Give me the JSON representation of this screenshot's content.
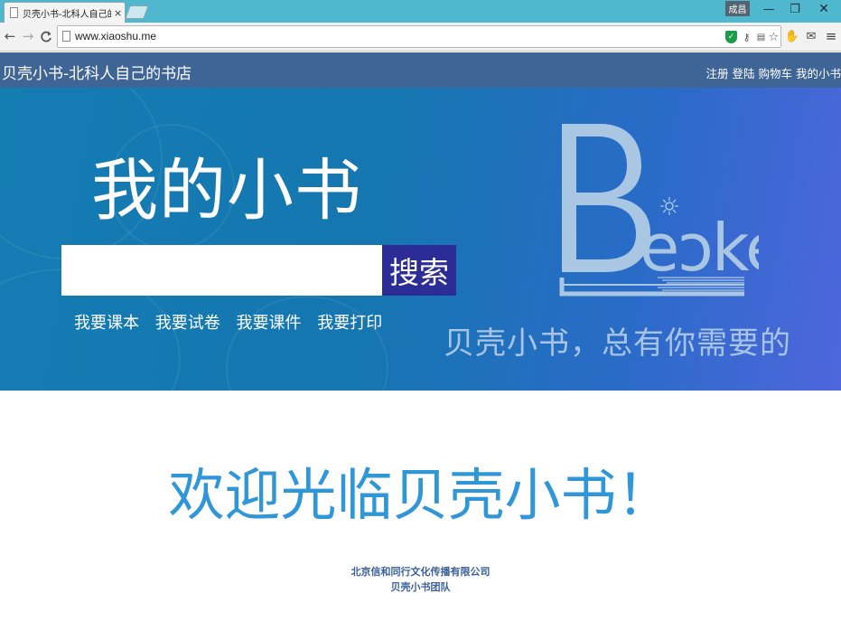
{
  "browser": {
    "tab_title": "贝壳小书-北科人自己的书",
    "tab_close": "×",
    "profile_label": "成昌",
    "window_controls": {
      "minimize": "—",
      "maximize": "❐",
      "close": "✕"
    },
    "nav": {
      "back": "←",
      "forward": "→",
      "reload": "C"
    },
    "url": "www.xiaoshu.me",
    "icons": [
      "page-icon",
      "shield-icon",
      "key-icon",
      "page-action-icon",
      "bookmark-star-icon",
      "extension-icon",
      "mail-extension-icon",
      "menu-icon"
    ]
  },
  "site": {
    "title": "贝壳小书-北科人自己的书店",
    "nav": [
      "注册",
      "登陆",
      "购物车",
      "我的小书"
    ]
  },
  "hero": {
    "title": "我的小书",
    "search": {
      "placeholder": "",
      "value": "",
      "button_label": "搜索"
    },
    "quick_links": [
      "我要课本",
      "我要试卷",
      "我要课件",
      "我要打印"
    ],
    "logo_text": "Beike",
    "tagline": "贝壳小书，总有你需要的"
  },
  "main": {
    "welcome": "欢迎光临贝壳小书！"
  },
  "footer": {
    "company": "北京信和同行文化传播有限公司",
    "team": "贝壳小书团队"
  },
  "colors": {
    "titlebar": "#4fb8cf",
    "header": "#3f6496",
    "hero_start": "#147db2",
    "hero_end": "#4f66dc",
    "search_button": "#2c2c97",
    "welcome": "#2f97d8",
    "footer": "#3a5f99"
  }
}
